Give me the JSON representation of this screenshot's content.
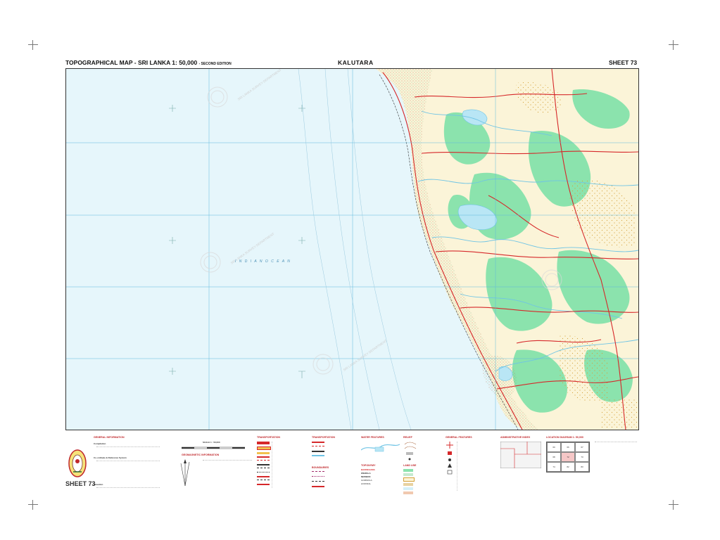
{
  "header": {
    "title": "TOPOGRAPHICAL MAP - SRI LANKA 1: 50,000",
    "edition": "- SECOND EDITION",
    "map_name": "KALUTARA",
    "sheet": "SHEET 73"
  },
  "map": {
    "ocean_label": "I N D I A N   O C E A N",
    "colors": {
      "sea": "#e6f6fb",
      "land": "#fbf4d8",
      "vegetation": "#8be3ad",
      "road": "#d6282a",
      "river": "#6fc4e5",
      "grid": "#5fb9dc",
      "settlement": "#c8755a"
    },
    "watermark_lines": [
      "ශ්‍රී ලංකා මිනින්දෝරු දෙපාර්තමේන්තුව",
      "இலங்கை நில அளவைத் திணைக்களம்",
      "SRI LANKA SURVEY DEPARTMENT"
    ]
  },
  "legend": {
    "general_information": "GENERAL INFORMATION",
    "compilation": "Compilation",
    "coordinate_systems": "Co-ordinate & Reference System",
    "elevation": "Elevation",
    "scale": "SCALE 1 : 50,000",
    "geomagnetic": "GEOMAGNETIC INFORMATION",
    "transportation": "TRANSPORTATION",
    "boundaries": "BOUNDARIES",
    "water_features": "WATER FEATURES",
    "toponymy": "TOPONYMY",
    "relief": "RELIEF",
    "land_use": "LAND USE",
    "general_features": "GENERAL FEATURES",
    "administrative_index": "ADMINISTRATIVE INDEX",
    "location_diagram": "LOCATION DIAGRAM 1: 50,000",
    "sheet_number": "SHEET 73",
    "toponymy_samples": [
      "BADDEGAMA",
      "WEWALA",
      "NEWBOK",
      "GOMMOLA",
      "HOFFRAL"
    ],
    "location_cells": [
      "60",
      "66",
      "67",
      "68",
      "72",
      "73",
      "74",
      "82",
      "83"
    ]
  }
}
